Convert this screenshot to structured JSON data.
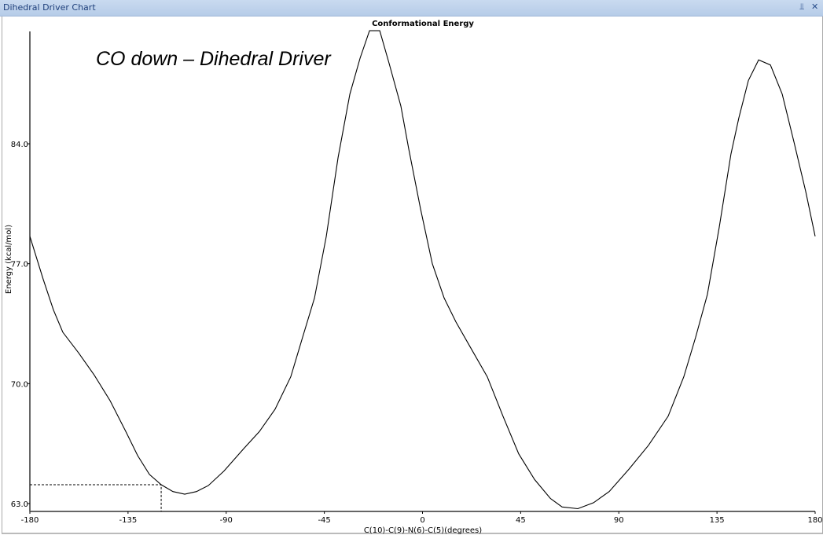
{
  "window": {
    "title": "Dihedral Driver Chart",
    "pin_icon": "pin-icon",
    "close_icon": "close-icon"
  },
  "annotation": "CO down – Dihedral Driver",
  "chart_data": {
    "type": "line",
    "title": "Conformational Energy",
    "xlabel": "C(10)-C(9)-N(6)-C(5)(degrees)",
    "ylabel": "Energy (kcal/mol)",
    "xlim": [
      -180,
      180
    ],
    "ylim": [
      62.54,
      90.56
    ],
    "xticks": [
      -180,
      -135,
      -90,
      -45,
      0,
      45,
      90,
      135,
      180
    ],
    "xtick_labels": [
      "-180",
      "-135",
      "-90",
      "-45",
      "0",
      "45",
      "90",
      "135",
      "180"
    ],
    "yticks": [
      63,
      70,
      77,
      84
    ],
    "ytick_labels": [
      "63.0",
      "70.0",
      "77.0",
      "84.0"
    ],
    "grid": false,
    "crosshair": {
      "x": -119.8,
      "y": 64.1
    },
    "series": [
      {
        "name": "Energy",
        "color": "#000000",
        "x": [
          -180,
          -173.9,
          -169.2,
          -164.9,
          -157.7,
          -150.5,
          -143.2,
          -136,
          -130.6,
          -125.2,
          -119.8,
          -114.4,
          -109,
          -103.6,
          -98.2,
          -91,
          -82,
          -74.8,
          -67.6,
          -60.4,
          -55,
          -49.5,
          -44.1,
          -38.7,
          -33.3,
          -28.6,
          -24.3,
          -19.6,
          -15.3,
          -9.9,
          -6.3,
          -0.9,
          4.5,
          9.9,
          15.3,
          22.5,
          29.7,
          36.9,
          44.1,
          51.4,
          58.6,
          64,
          71.2,
          78.4,
          85.6,
          94.6,
          103.6,
          112.6,
          119.8,
          125.2,
          130.6,
          136,
          141.4,
          145,
          149.4,
          154.1,
          159.5,
          164.9,
          170.3,
          175.7,
          180
        ],
        "y": [
          78.6,
          76.1,
          74.3,
          73.0,
          71.8,
          70.5,
          69.0,
          67.2,
          65.8,
          64.7,
          64.1,
          63.7,
          63.55,
          63.7,
          64.05,
          64.9,
          66.2,
          67.2,
          68.5,
          70.4,
          72.7,
          75.0,
          78.6,
          83.2,
          86.9,
          89.0,
          90.6,
          90.6,
          88.7,
          86.2,
          83.7,
          80.2,
          77.0,
          75.0,
          73.6,
          72.0,
          70.4,
          68.1,
          65.9,
          64.4,
          63.3,
          62.8,
          62.7,
          63.05,
          63.7,
          65.0,
          66.4,
          68.1,
          70.4,
          72.7,
          75.2,
          79.1,
          83.4,
          85.5,
          87.7,
          88.9,
          88.6,
          86.9,
          84.1,
          81.2,
          78.6
        ]
      }
    ]
  }
}
